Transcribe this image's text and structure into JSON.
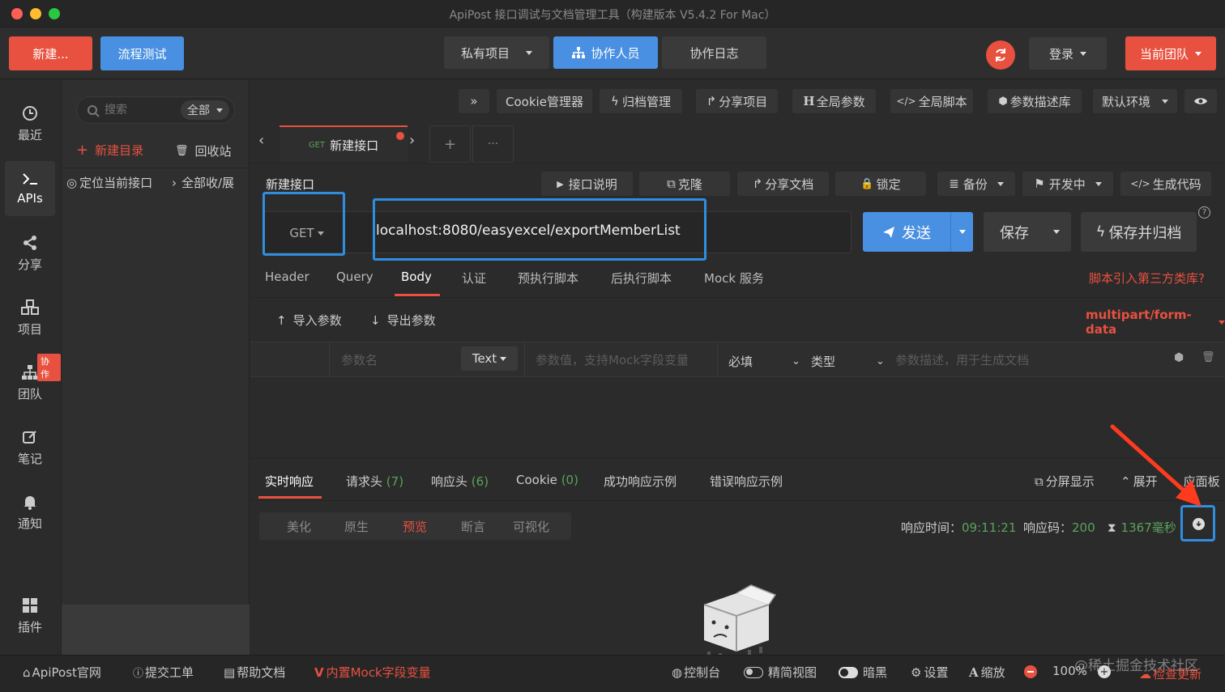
{
  "window": {
    "title": "ApiPost 接口调试与文档管理工具（构建版本 V5.4.2 For Mac）"
  },
  "toolbar": {
    "new_label": "新建...",
    "flow_test_label": "流程测试",
    "private_project_label": "私有项目",
    "collaborators_label": "协作人员",
    "collab_log_label": "协作日志",
    "login_label": "登录",
    "current_team_label": "当前团队"
  },
  "leftnav": {
    "items": [
      {
        "label": "最近",
        "icon": "clock-icon"
      },
      {
        "label": "APIs",
        "icon": "terminal-icon"
      },
      {
        "label": "分享",
        "icon": "share-icon"
      },
      {
        "label": "项目",
        "icon": "cubes-icon"
      },
      {
        "label": "团队",
        "icon": "sitemap-icon",
        "badge": "协作"
      },
      {
        "label": "笔记",
        "icon": "edit-icon"
      },
      {
        "label": "通知",
        "icon": "bell-icon"
      },
      {
        "label": "插件",
        "icon": "grid-icon"
      }
    ]
  },
  "tree": {
    "search_placeholder": "搜索",
    "filter_label": "全部",
    "new_dir_label": "新建目录",
    "recycle_label": "回收站",
    "locate_label": "定位当前接口",
    "collapse_label": "全部收/展"
  },
  "secondary_toolbar": {
    "cookie_label": "Cookie管理器",
    "archive_label": "归档管理",
    "share_project_label": "分享项目",
    "global_params_label": "全局参数",
    "global_script_label": "全局脚本",
    "param_desc_label": "参数描述库",
    "env_label": "默认环境"
  },
  "tabs": [
    {
      "method": "GET",
      "label": "新建接口"
    }
  ],
  "request": {
    "name": "新建接口",
    "method": "GET",
    "url": "localhost:8080/easyexcel/exportMemberList",
    "send_label": "发送",
    "save_label": "保存",
    "save_archive_label": "保存并归档",
    "actions": [
      "接口说明",
      "克隆",
      "分享文档",
      "锁定",
      "备份",
      "开发中",
      "生成代码"
    ]
  },
  "req_tabs": {
    "items": [
      "Header",
      "Query",
      "Body",
      "认证",
      "预执行脚本",
      "后执行脚本",
      "Mock 服务"
    ],
    "active": "Body",
    "third_party_link": "脚本引入第三方类库?"
  },
  "body": {
    "import_label": "导入参数",
    "export_label": "导出参数",
    "content_type": "multipart/form-data",
    "param_name_placeholder": "参数名",
    "type_value": "Text",
    "param_value_placeholder": "参数值，支持Mock字段变量",
    "required_label": "必填",
    "kind_label": "类型",
    "param_desc_placeholder": "参数描述，用于生成文档"
  },
  "response": {
    "tabs": [
      {
        "label": "实时响应",
        "count": ""
      },
      {
        "label": "请求头",
        "count": "(7)"
      },
      {
        "label": "响应头",
        "count": "(6)"
      },
      {
        "label": "Cookie",
        "count": "(0)"
      },
      {
        "label": "成功响应示例",
        "count": ""
      },
      {
        "label": "错误响应示例",
        "count": ""
      }
    ],
    "split_label": "分屏显示",
    "expand_label": "展开",
    "panel_label": "应面板",
    "view_modes": [
      "美化",
      "原生",
      "预览",
      "断言",
      "可视化"
    ],
    "active_view": "预览",
    "time_label": "响应时间：",
    "time_value": "09:11:21",
    "code_label": "响应码：",
    "code_value": "200",
    "duration_value": "1367毫秒"
  },
  "footer": {
    "official_label": "ApiPost官网",
    "ticket_label": "提交工单",
    "help_label": "帮助文档",
    "mock_label": "内置Mock字段变量",
    "console_label": "控制台",
    "simple_view_label": "精简视图",
    "dark_label": "暗黑",
    "settings_label": "设置",
    "zoom_label": "缩放",
    "zoom_value": "100%",
    "update_label": "检查更新",
    "watermark": "@稀土掘金技术社区"
  },
  "colors": {
    "accent": "#4a90e2",
    "brand_red": "#e8513f",
    "highlight": "#2f8ee0"
  }
}
